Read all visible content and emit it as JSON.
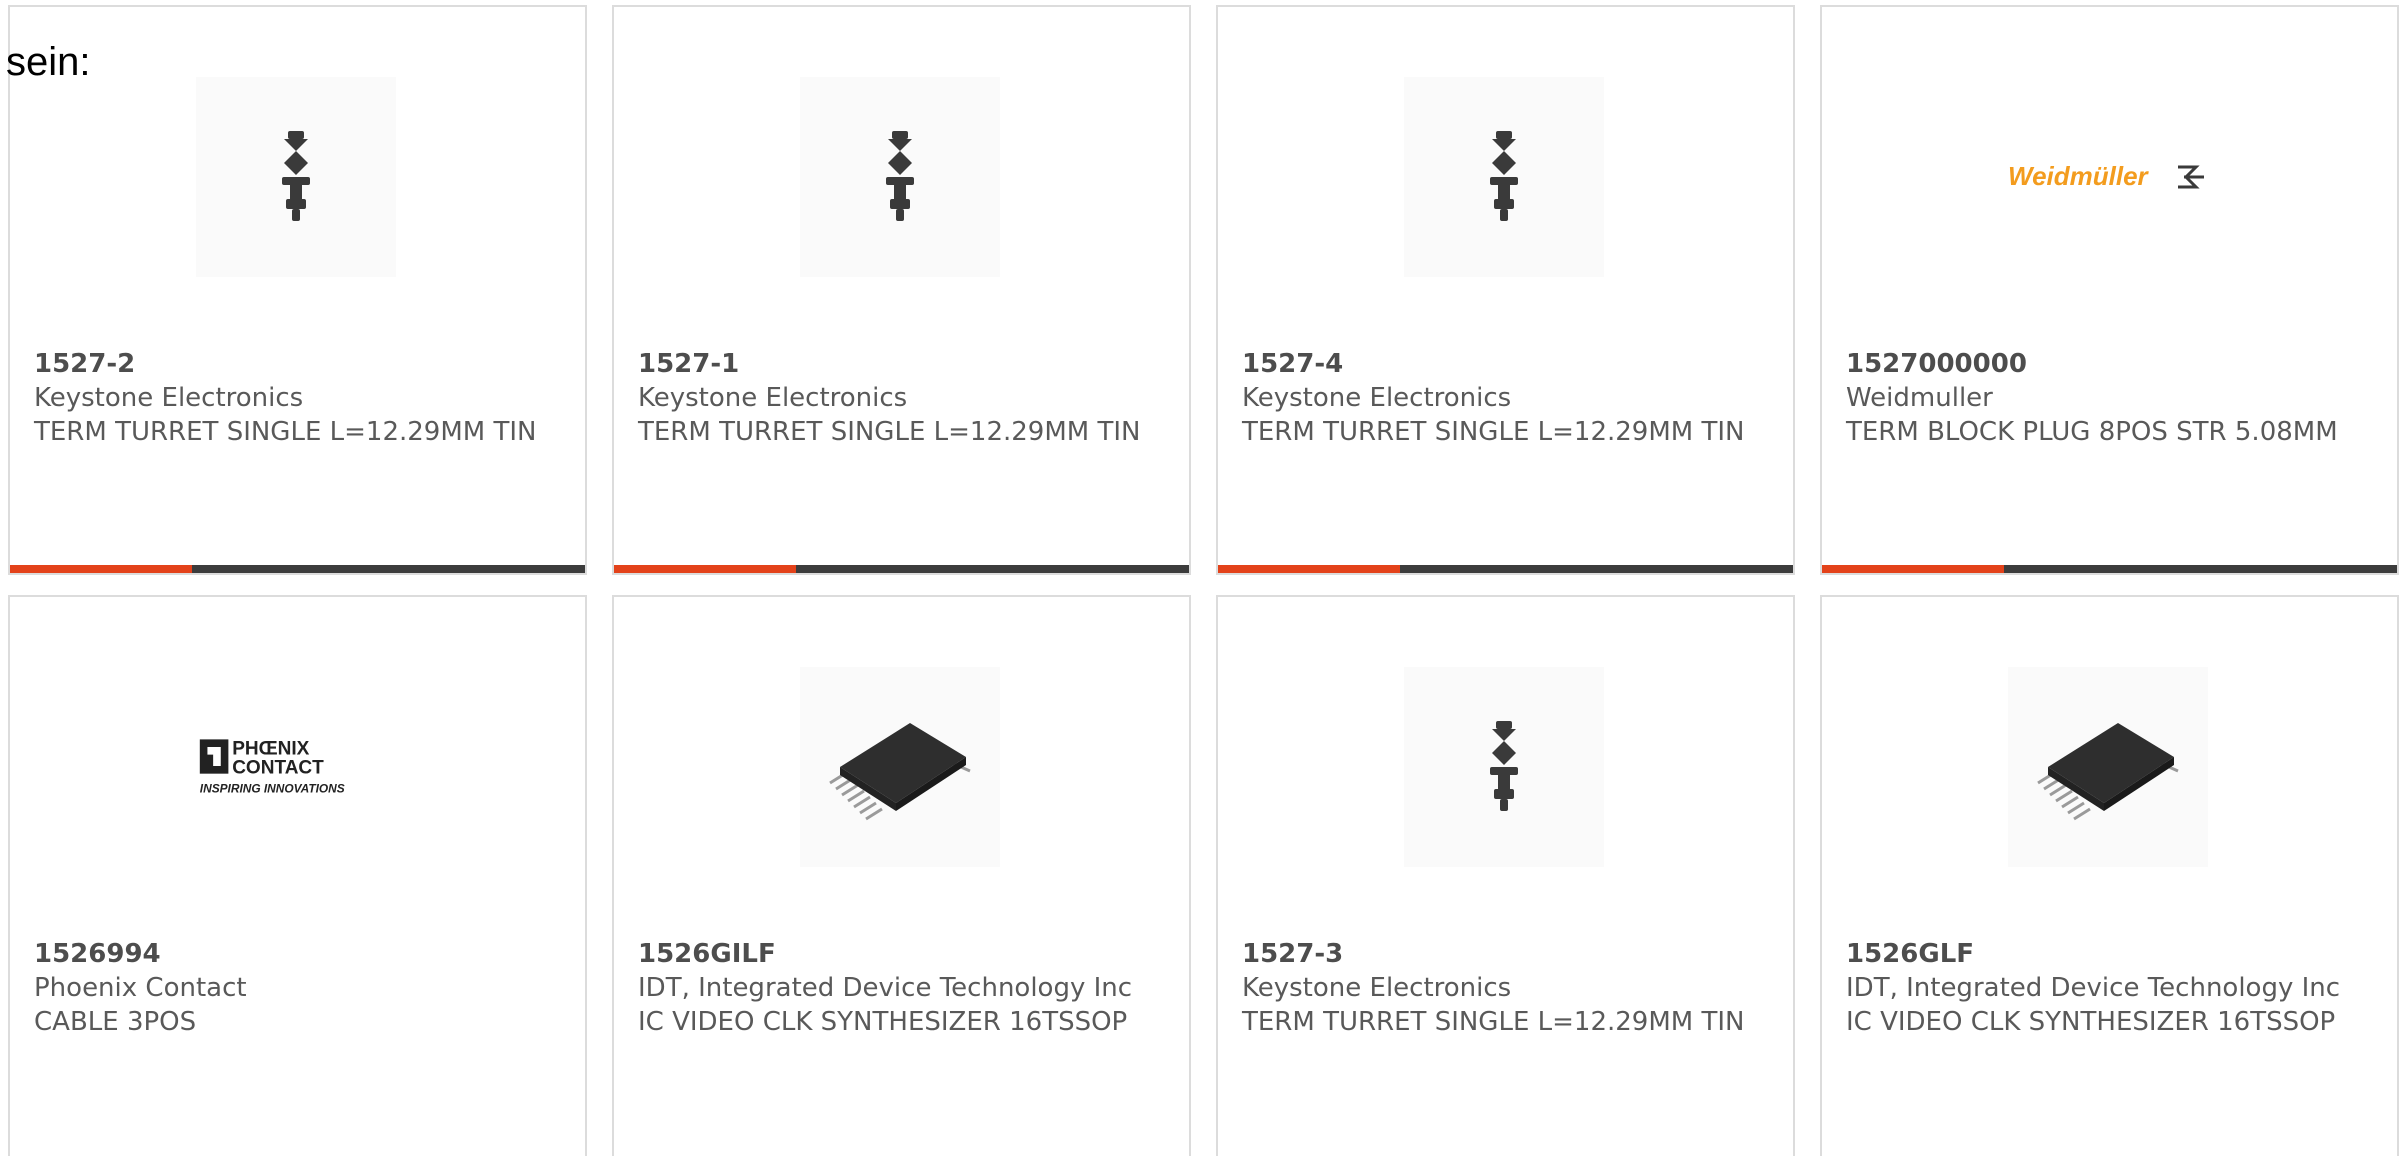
{
  "intro_text": "sein:",
  "colors": {
    "accent": "#e3421a",
    "bar": "#3c3c3c",
    "border": "#dcdcdc",
    "weidmuller": "#f39c1e"
  },
  "products": [
    {
      "part_number": "1527-2",
      "manufacturer": "Keystone Electronics",
      "description": "TERM TURRET SINGLE L=12.29MM TIN",
      "image": "turret-terminal-icon"
    },
    {
      "part_number": "1527-1",
      "manufacturer": "Keystone Electronics",
      "description": "TERM TURRET SINGLE L=12.29MM TIN",
      "image": "turret-terminal-icon"
    },
    {
      "part_number": "1527-4",
      "manufacturer": "Keystone Electronics",
      "description": "TERM TURRET SINGLE L=12.29MM TIN",
      "image": "turret-terminal-icon"
    },
    {
      "part_number": "1527000000",
      "manufacturer": "Weidmuller",
      "description": "TERM BLOCK PLUG 8POS STR 5.08MM",
      "image": "weidmuller-logo",
      "logo_text": "Weidmüller"
    },
    {
      "part_number": "1526994",
      "manufacturer": "Phoenix Contact",
      "description": "CABLE 3POS",
      "image": "phoenix-contact-logo",
      "logo_text_1": "PHŒNIX",
      "logo_text_2": "CONTACT",
      "logo_tagline": "INSPIRING INNOVATIONS"
    },
    {
      "part_number": "1526GILF",
      "manufacturer": "IDT, Integrated Device Technology Inc",
      "description": "IC VIDEO CLK SYNTHESIZER 16TSSOP",
      "image": "tssop-chip-icon"
    },
    {
      "part_number": "1527-3",
      "manufacturer": "Keystone Electronics",
      "description": "TERM TURRET SINGLE L=12.29MM TIN",
      "image": "turret-terminal-icon"
    },
    {
      "part_number": "1526GLF",
      "manufacturer": "IDT, Integrated Device Technology Inc",
      "description": "IC VIDEO CLK SYNTHESIZER 16TSSOP",
      "image": "tssop-chip-icon"
    }
  ]
}
